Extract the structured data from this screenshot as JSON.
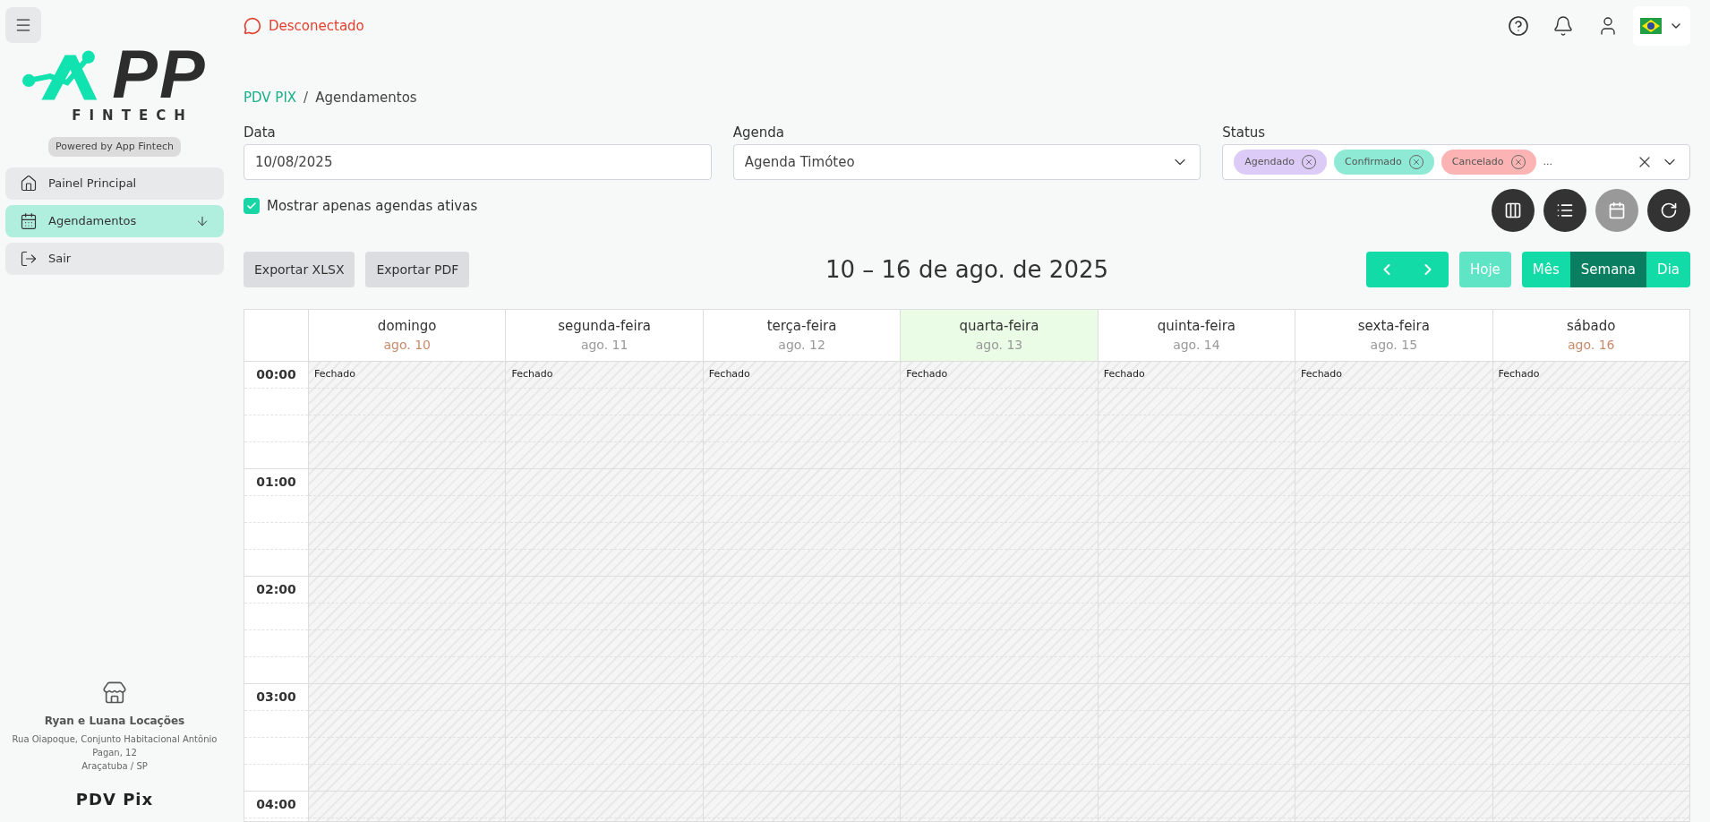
{
  "sidebar": {
    "logo": {
      "text": "PP",
      "subtitle": "FINTECH",
      "badge": "Powered by App Fintech"
    },
    "items": [
      {
        "label": "Painel Principal",
        "kind": "home",
        "selected": false,
        "expandable": false
      },
      {
        "label": "Agendamentos",
        "kind": "calendar",
        "selected": true,
        "expandable": true
      },
      {
        "label": "Sair",
        "kind": "logout",
        "selected": false,
        "expandable": false
      }
    ],
    "store": {
      "name": "Ryan e Luana Locações",
      "address": "Rua Oiapoque, Conjunto Habitacional Antônio Pagan, 12",
      "city": "Araçatuba / SP"
    },
    "footer": "PDV Pix"
  },
  "header": {
    "connection": {
      "label": "Desconectado",
      "connected": false
    }
  },
  "breadcrumb": {
    "root": "PDV PIX",
    "separator": "/",
    "current": "Agendamentos"
  },
  "filters": {
    "date": {
      "label": "Data",
      "value": "10/08/2025"
    },
    "agenda": {
      "label": "Agenda",
      "value": "Agenda Timóteo"
    },
    "status": {
      "label": "Status",
      "chips": [
        {
          "label": "Agendado",
          "color": "#dccbf7"
        },
        {
          "label": "Confirmado",
          "color": "#8eead5"
        },
        {
          "label": "Cancelado",
          "color": "#fbb3b3"
        }
      ],
      "more": "..."
    },
    "active_only": {
      "label": "Mostrar apenas agendas ativas",
      "checked": true
    }
  },
  "view_buttons": [
    {
      "kind": "columns",
      "disabled": false
    },
    {
      "kind": "list",
      "disabled": false
    },
    {
      "kind": "calendar",
      "disabled": true
    },
    {
      "kind": "refresh",
      "disabled": false
    }
  ],
  "toolbar": {
    "exports": [
      "Exportar XLSX",
      "Exportar PDF"
    ],
    "title": "10 – 16 de ago. de 2025",
    "today": {
      "label": "Hoje",
      "disabled": true
    },
    "views": [
      {
        "label": "Mês",
        "selected": false
      },
      {
        "label": "Semana",
        "selected": true
      },
      {
        "label": "Dia",
        "selected": false
      }
    ]
  },
  "calendar": {
    "days": [
      {
        "name": "domingo",
        "date": "ago. 10",
        "weekend": true,
        "today": false,
        "closed": "Fechado"
      },
      {
        "name": "segunda-feira",
        "date": "ago. 11",
        "weekend": false,
        "today": false,
        "closed": "Fechado"
      },
      {
        "name": "terça-feira",
        "date": "ago. 12",
        "weekend": false,
        "today": false,
        "closed": "Fechado"
      },
      {
        "name": "quarta-feira",
        "date": "ago. 13",
        "weekend": false,
        "today": true,
        "closed": "Fechado"
      },
      {
        "name": "quinta-feira",
        "date": "ago. 14",
        "weekend": false,
        "today": false,
        "closed": "Fechado"
      },
      {
        "name": "sexta-feira",
        "date": "ago. 15",
        "weekend": false,
        "today": false,
        "closed": "Fechado"
      },
      {
        "name": "sábado",
        "date": "ago. 16",
        "weekend": true,
        "today": false,
        "closed": "Fechado"
      }
    ],
    "hours": [
      "00:00",
      "01:00",
      "02:00",
      "03:00",
      "04:00"
    ]
  }
}
